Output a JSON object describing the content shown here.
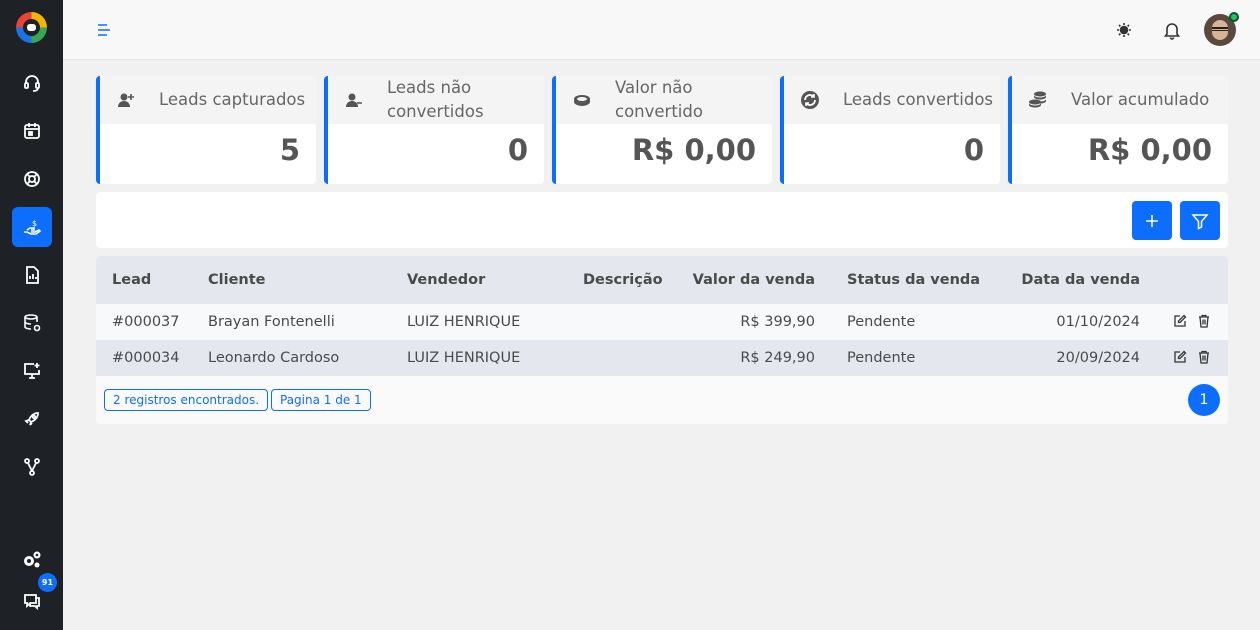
{
  "colors": {
    "accent": "#0d6efd",
    "sidebar": "#1e2126",
    "background": "#f1f1f1"
  },
  "sidebar": {
    "items": [
      {
        "icon": "headset-icon"
      },
      {
        "icon": "calendar-icon"
      },
      {
        "icon": "lifebuoy-icon"
      },
      {
        "icon": "hand-money-icon",
        "active": true
      },
      {
        "icon": "report-icon"
      },
      {
        "icon": "database-settings-icon"
      },
      {
        "icon": "monitor-plus-icon"
      },
      {
        "icon": "rocket-icon"
      },
      {
        "icon": "flow-icon"
      }
    ],
    "settings_icon": "gears-icon",
    "chat_icon": "chat-icon",
    "chat_badge": "91"
  },
  "topbar": {
    "menu_icon": "menu-icon",
    "theme_icon": "sun-icon",
    "notification_icon": "bell-icon"
  },
  "stats": [
    {
      "label": "Leads capturados",
      "value": "5",
      "icon": "user-plus-icon"
    },
    {
      "label": "Leads não convertidos",
      "value": "0",
      "icon": "user-minus-icon"
    },
    {
      "label": "Valor não convertido",
      "value": "R$ 0,00",
      "icon": "coin-icon"
    },
    {
      "label": "Leads convertidos",
      "value": "0",
      "icon": "convert-icon"
    },
    {
      "label": "Valor acumulado",
      "value": "R$ 0,00",
      "icon": "coins-stack-icon"
    }
  ],
  "actions": {
    "add_icon": "plus-icon",
    "filter_icon": "filter-icon"
  },
  "table": {
    "headers": [
      "Lead",
      "Cliente",
      "Vendedor",
      "Descrição",
      "Valor da venda",
      "Status da venda",
      "Data da venda"
    ],
    "rows": [
      {
        "lead": "#000037",
        "cliente": "Brayan Fontenelli",
        "vendedor": "LUIZ HENRIQUE",
        "descricao": "",
        "valor": "R$ 399,90",
        "status": "Pendente",
        "data": "01/10/2024"
      },
      {
        "lead": "#000034",
        "cliente": "Leonardo Cardoso",
        "vendedor": "LUIZ HENRIQUE",
        "descricao": "",
        "valor": "R$ 249,90",
        "status": "Pendente",
        "data": "20/09/2024"
      }
    ],
    "footer": {
      "records": "2 registros encontrados.",
      "page_info": "Pagina 1 de 1",
      "current_page": "1"
    }
  }
}
